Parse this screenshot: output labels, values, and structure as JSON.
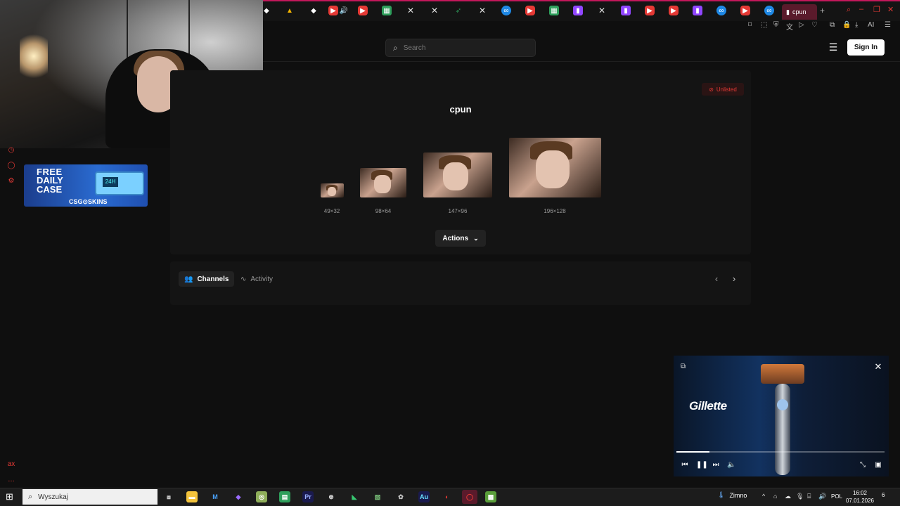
{
  "browser": {
    "active_tab_label": "cpun",
    "new_tab_symbol": "+",
    "toolbar_ai_label": "AI"
  },
  "header": {
    "search_placeholder": "Search",
    "sign_in_label": "Sign In"
  },
  "ad": {
    "line1": "FREE",
    "line2": "DAILY",
    "line3": "CASE",
    "badge": "24H",
    "brand": "CSG⊙SKINS"
  },
  "emote": {
    "status_badge": "Unlisted",
    "title": "cpun",
    "sizes": [
      "49×32",
      "98×64",
      "147×96",
      "196×128"
    ],
    "actions_label": "Actions"
  },
  "tabs": {
    "channels_label": "Channels",
    "activity_label": "Activity"
  },
  "pip": {
    "ad_brand": "Gillette",
    "progress_fraction": 0.16
  },
  "taskbar": {
    "search_placeholder": "Wyszukaj",
    "weather": "Zimno",
    "language": "POL",
    "time": "16:02",
    "date": "07.01.2026",
    "notification_count": "6"
  },
  "colors": {
    "accent": "#e53935",
    "brand_bar": "#c2185b",
    "background": "#0f0f0f",
    "card": "#141414"
  }
}
